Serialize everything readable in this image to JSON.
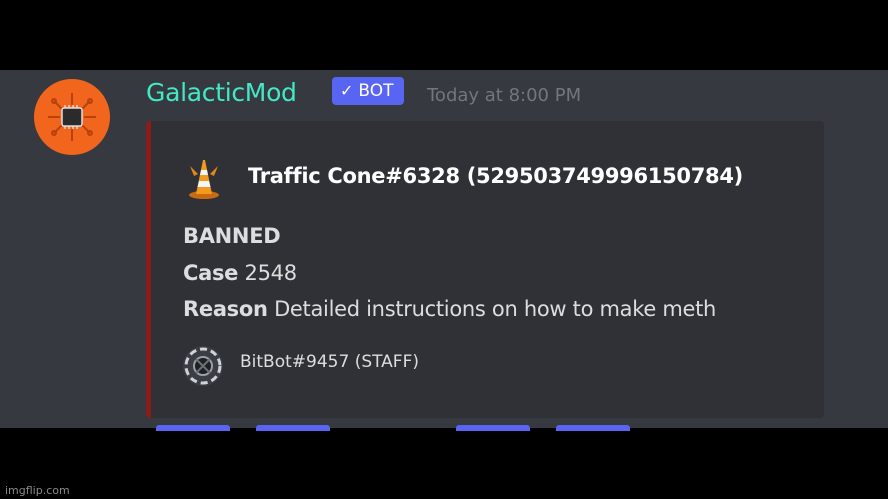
{
  "message": {
    "username": "GalacticMod",
    "bot_tag": {
      "check_glyph": "✓",
      "label": "BOT"
    },
    "timestamp": "Today at 8:00 PM",
    "avatar_icon": "circuit-chip-icon"
  },
  "embed": {
    "accent_color": "#8a1c1c",
    "author": {
      "icon": "traffic-cone-icon",
      "name": "Traffic Cone#6328 (529503749996150784)"
    },
    "status": "BANNED",
    "case": {
      "label": "Case",
      "value": "2548"
    },
    "reason": {
      "label": "Reason",
      "value": "Detailed instructions on how to make meth"
    },
    "footer": {
      "icon": "bitbot-avatar-icon",
      "text": "BitBot#9457 (STAFF)"
    }
  },
  "colors": {
    "background": "#36393f",
    "embed_background": "#2f3136",
    "username": "#43e8c6",
    "bot_tag": "#5865f2",
    "timestamp": "#72767d"
  },
  "watermark": "imgflip.com"
}
